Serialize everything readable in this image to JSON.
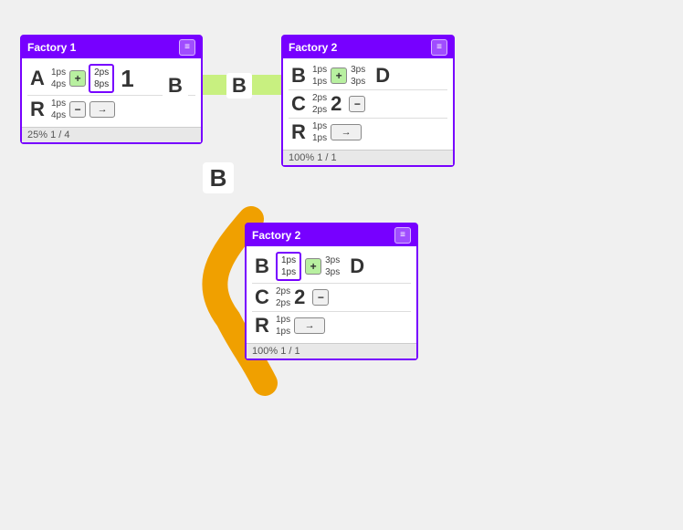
{
  "factory1": {
    "title": "Factory 1",
    "header_btn": "≡",
    "rows": [
      {
        "letter": "A",
        "ps_top": "1ps",
        "ps_bot": "4ps",
        "btn": "+",
        "badge": "1",
        "ps2_top": "2ps",
        "ps2_bot": "8ps",
        "letter2": "B"
      },
      {
        "letter": "R",
        "ps_top": "1ps",
        "ps_bot": "4ps",
        "btn": "−",
        "btn2": "→"
      }
    ],
    "footer": "25% 1 / 4"
  },
  "factory2_top": {
    "title": "Factory 2",
    "header_btn": "≡",
    "rows": [
      {
        "letter": "B",
        "ps_top": "1ps",
        "ps_bot": "1ps",
        "btn": "+",
        "ps2_top": "3ps",
        "ps2_bot": "3ps",
        "letter2": "D"
      },
      {
        "letter": "C",
        "ps_top": "2ps",
        "ps_bot": "2ps",
        "btn": "−",
        "badge": "2"
      },
      {
        "letter": "R",
        "ps_top": "1ps",
        "ps_bot": "1ps",
        "btn2": "→"
      }
    ],
    "footer": "100% 1 / 1"
  },
  "factory2_bot": {
    "title": "Factory 2",
    "header_btn": "≡",
    "rows": [
      {
        "letter": "B",
        "ps_top": "1ps",
        "ps_bot": "1ps",
        "btn": "+",
        "ps2_top": "3ps",
        "ps2_bot": "3ps",
        "letter2": "D"
      },
      {
        "letter": "C",
        "ps_top": "2ps",
        "ps_bot": "2ps",
        "btn": "−",
        "badge": "2"
      },
      {
        "letter": "R",
        "ps_top": "1ps",
        "ps_bot": "1ps",
        "btn2": "→"
      }
    ],
    "footer": "100% 1 / 1"
  },
  "connector_letters": {
    "top_B": "B",
    "mid_B": "B",
    "bot_B": "B"
  }
}
